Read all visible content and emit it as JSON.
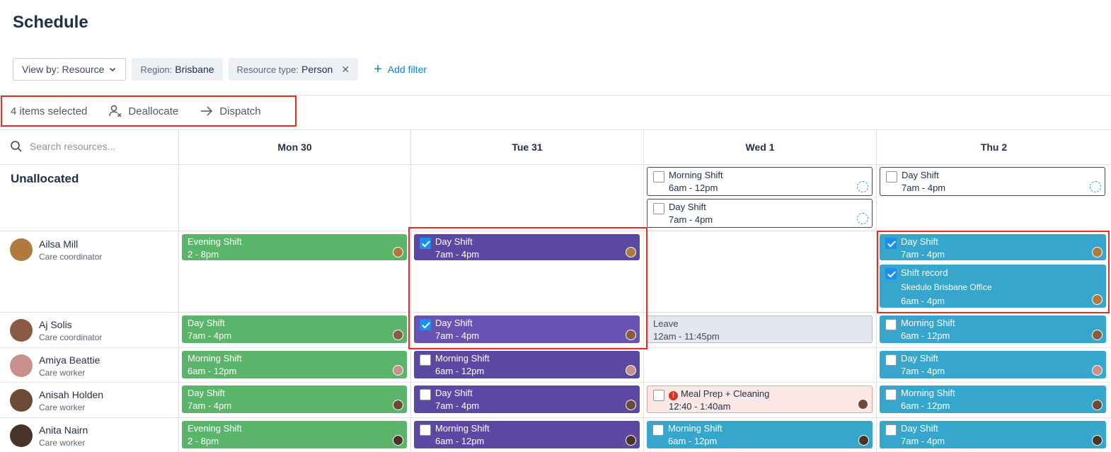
{
  "page": {
    "title": "Schedule"
  },
  "filters": {
    "view_by": "View by: Resource",
    "region_label": "Region:",
    "region_value": "Brisbane",
    "resource_type_label": "Resource type:",
    "resource_type_value": "Person",
    "add_filter": "Add filter"
  },
  "selection": {
    "count_text": "4 items selected",
    "deallocate": "Deallocate",
    "dispatch": "Dispatch"
  },
  "grid": {
    "search_placeholder": "Search resources...",
    "days": [
      "Mon 30",
      "Tue 31",
      "Wed 1",
      "Thu 2"
    ],
    "unallocated_label": "Unallocated"
  },
  "resources": [
    {
      "name": "Ailsa Mill",
      "role": "Care coordinator",
      "avatar_color": "#b07a3e"
    },
    {
      "name": "Aj Solis",
      "role": "Care coordinator",
      "avatar_color": "#8a5a44"
    },
    {
      "name": "Amiya Beattie",
      "role": "Care worker",
      "avatar_color": "#c98f8c"
    },
    {
      "name": "Anisah Holden",
      "role": "Care worker",
      "avatar_color": "#6b4a36"
    },
    {
      "name": "Anita Nairn",
      "role": "Care worker",
      "avatar_color": "#4a3328"
    }
  ],
  "shifts": {
    "unalloc_wed_1": {
      "title": "Morning Shift",
      "time": "6am - 12pm"
    },
    "unalloc_wed_2": {
      "title": "Day Shift",
      "time": "7am - 4pm"
    },
    "unalloc_thu_1": {
      "title": "Day Shift",
      "time": "7am - 4pm"
    },
    "ailsa_mon": {
      "title": "Evening Shift",
      "time": "2 - 8pm"
    },
    "ailsa_tue": {
      "title": "Day Shift",
      "time": "7am - 4pm"
    },
    "ailsa_thu_1": {
      "title": "Day Shift",
      "time": "7am - 4pm"
    },
    "ailsa_thu_2": {
      "title": "Shift record",
      "location": "Skedulo Brisbane Office",
      "time": "6am - 4pm"
    },
    "aj_mon": {
      "title": "Day Shift",
      "time": "7am - 4pm"
    },
    "aj_tue": {
      "title": "Day Shift",
      "time": "7am - 4pm"
    },
    "aj_wed": {
      "title": "Leave",
      "time": "12am - 11:45pm"
    },
    "aj_thu": {
      "title": "Morning Shift",
      "time": "6am - 12pm"
    },
    "amiya_mon": {
      "title": "Morning Shift",
      "time": "6am - 12pm"
    },
    "amiya_tue": {
      "title": "Morning Shift",
      "time": "6am - 12pm"
    },
    "amiya_thu": {
      "title": "Day Shift",
      "time": "7am - 4pm"
    },
    "anisah_mon": {
      "title": "Day Shift",
      "time": "7am - 4pm"
    },
    "anisah_tue": {
      "title": "Day Shift",
      "time": "7am - 4pm"
    },
    "anisah_wed": {
      "title": "Meal Prep + Cleaning",
      "time": "12:40 - 1:40am"
    },
    "anisah_thu": {
      "title": "Morning Shift",
      "time": "6am - 12pm"
    },
    "anita_mon": {
      "title": "Evening Shift",
      "time": "2 - 8pm"
    },
    "anita_tue": {
      "title": "Morning Shift",
      "time": "6am - 12pm"
    },
    "anita_wed": {
      "title": "Morning Shift",
      "time": "6am - 12pm"
    },
    "anita_thu": {
      "title": "Day Shift",
      "time": "7am - 4pm"
    }
  },
  "colors": {
    "green": "#5ab56b",
    "purple": "#5b48a3",
    "teal": "#37a6cc",
    "highlight": "#e0321f",
    "accent": "#0b86d6"
  }
}
